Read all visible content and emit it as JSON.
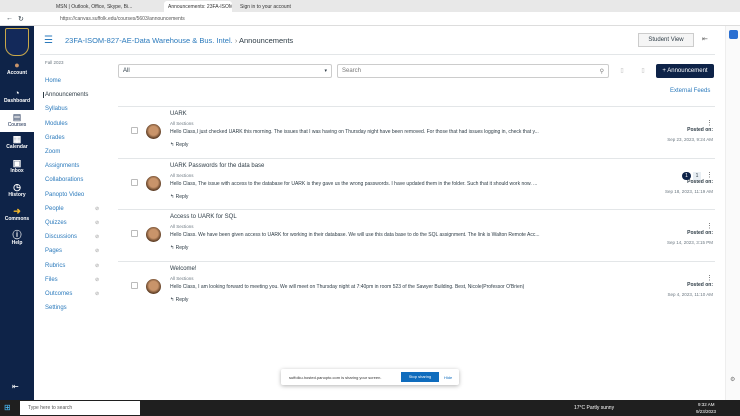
{
  "browser": {
    "tabs": [
      "MSN | Outlook, Office, Skype, Bi...",
      "Announcements: 23FA-ISOM-8...",
      "Sign in to your account"
    ],
    "url": "https://canvas.suffolk.edu/courses/5603/announcements"
  },
  "global_nav": [
    {
      "label": "Account",
      "icon": "avatar"
    },
    {
      "label": "Dashboard",
      "icon": "dashboard-icon"
    },
    {
      "label": "Courses",
      "icon": "book-icon"
    },
    {
      "label": "Calendar",
      "icon": "calendar-icon"
    },
    {
      "label": "Inbox",
      "icon": "inbox-icon"
    },
    {
      "label": "History",
      "icon": "clock-icon"
    },
    {
      "label": "Commons",
      "icon": "commons-icon"
    },
    {
      "label": "Help",
      "icon": "help-icon"
    }
  ],
  "header": {
    "course": "23FA-ISOM-827-AE-Data Warehouse & Bus. Intel.",
    "sep": "›",
    "page": "Announcements",
    "student_view": "Student View"
  },
  "course_nav": {
    "term": "Fall 2023",
    "items": [
      {
        "label": "Home"
      },
      {
        "label": "Announcements",
        "active": true
      },
      {
        "label": "Syllabus"
      },
      {
        "label": "Modules"
      },
      {
        "label": "Grades"
      },
      {
        "label": "Zoom"
      },
      {
        "label": "Assignments"
      },
      {
        "label": "Collaborations"
      },
      {
        "label": "Panopto Video"
      },
      {
        "label": "People",
        "hidden": true
      },
      {
        "label": "Quizzes",
        "hidden": true
      },
      {
        "label": "Discussions",
        "hidden": true
      },
      {
        "label": "Pages",
        "hidden": true
      },
      {
        "label": "Rubrics",
        "hidden": true
      },
      {
        "label": "Files",
        "hidden": true
      },
      {
        "label": "Outcomes",
        "hidden": true
      },
      {
        "label": "Settings"
      }
    ]
  },
  "toolbar": {
    "filter": "All",
    "search_placeholder": "Search",
    "add_button": "+ Announcement",
    "external_feeds": "External Feeds"
  },
  "announcements": [
    {
      "title": "UARK",
      "sections": "All Sections",
      "message": "Hello Class,I just checked UARK this morning. The issues that I was having on Thursday night have been removed.  For those that had issues logging in, check that y...",
      "reply": "Reply",
      "posted_label": "Posted on:",
      "date": "Sep 23, 2023, 9:24 AM"
    },
    {
      "title": "UARK Passwords for the data base",
      "sections": "All Sections",
      "message": "Hello Class, The issue with access to the database for UARK is they gave us the wrong passwords. I have updated them in the folder. Such that it should work now. ...",
      "reply": "Reply",
      "posted_label": "Posted on:",
      "date": "Sep 18, 2023, 11:19 AM",
      "unread": "1",
      "total": "1"
    },
    {
      "title": "Access to UARK for SQL",
      "sections": "All Sections",
      "message": "Hello Class. We have been given access to UARK for working in their database. We will use this data base to do the SQL assignment. The link is Walton Remote Acc...",
      "reply": "Reply",
      "posted_label": "Posted on:",
      "date": "Sep 14, 2023, 3:15 PM"
    },
    {
      "title": "Welcome!",
      "sections": "All Sections",
      "message": "Hello Class, I am looking forward to meeting you. We will meet on Thursday night at 7:40pm in room 523 of the Sawyer Building.  Best, Nicole(Professor O'Brien)",
      "reply": "Reply",
      "posted_label": "Posted on:",
      "date": "Sep 4, 2023, 11:10 AM"
    }
  ],
  "share_bar": {
    "text": "suffolku.hosted.panopto.com is sharing your screen.",
    "stop": "Stop sharing",
    "hide": "Hide"
  },
  "taskbar": {
    "search": "Type here to search",
    "weather": "17°C  Partly sunny",
    "time": "9:32 AM",
    "date": "9/23/2023"
  },
  "colors": {
    "nav": "#0e2348",
    "link": "#2b7abc",
    "button": "#0e2348"
  }
}
